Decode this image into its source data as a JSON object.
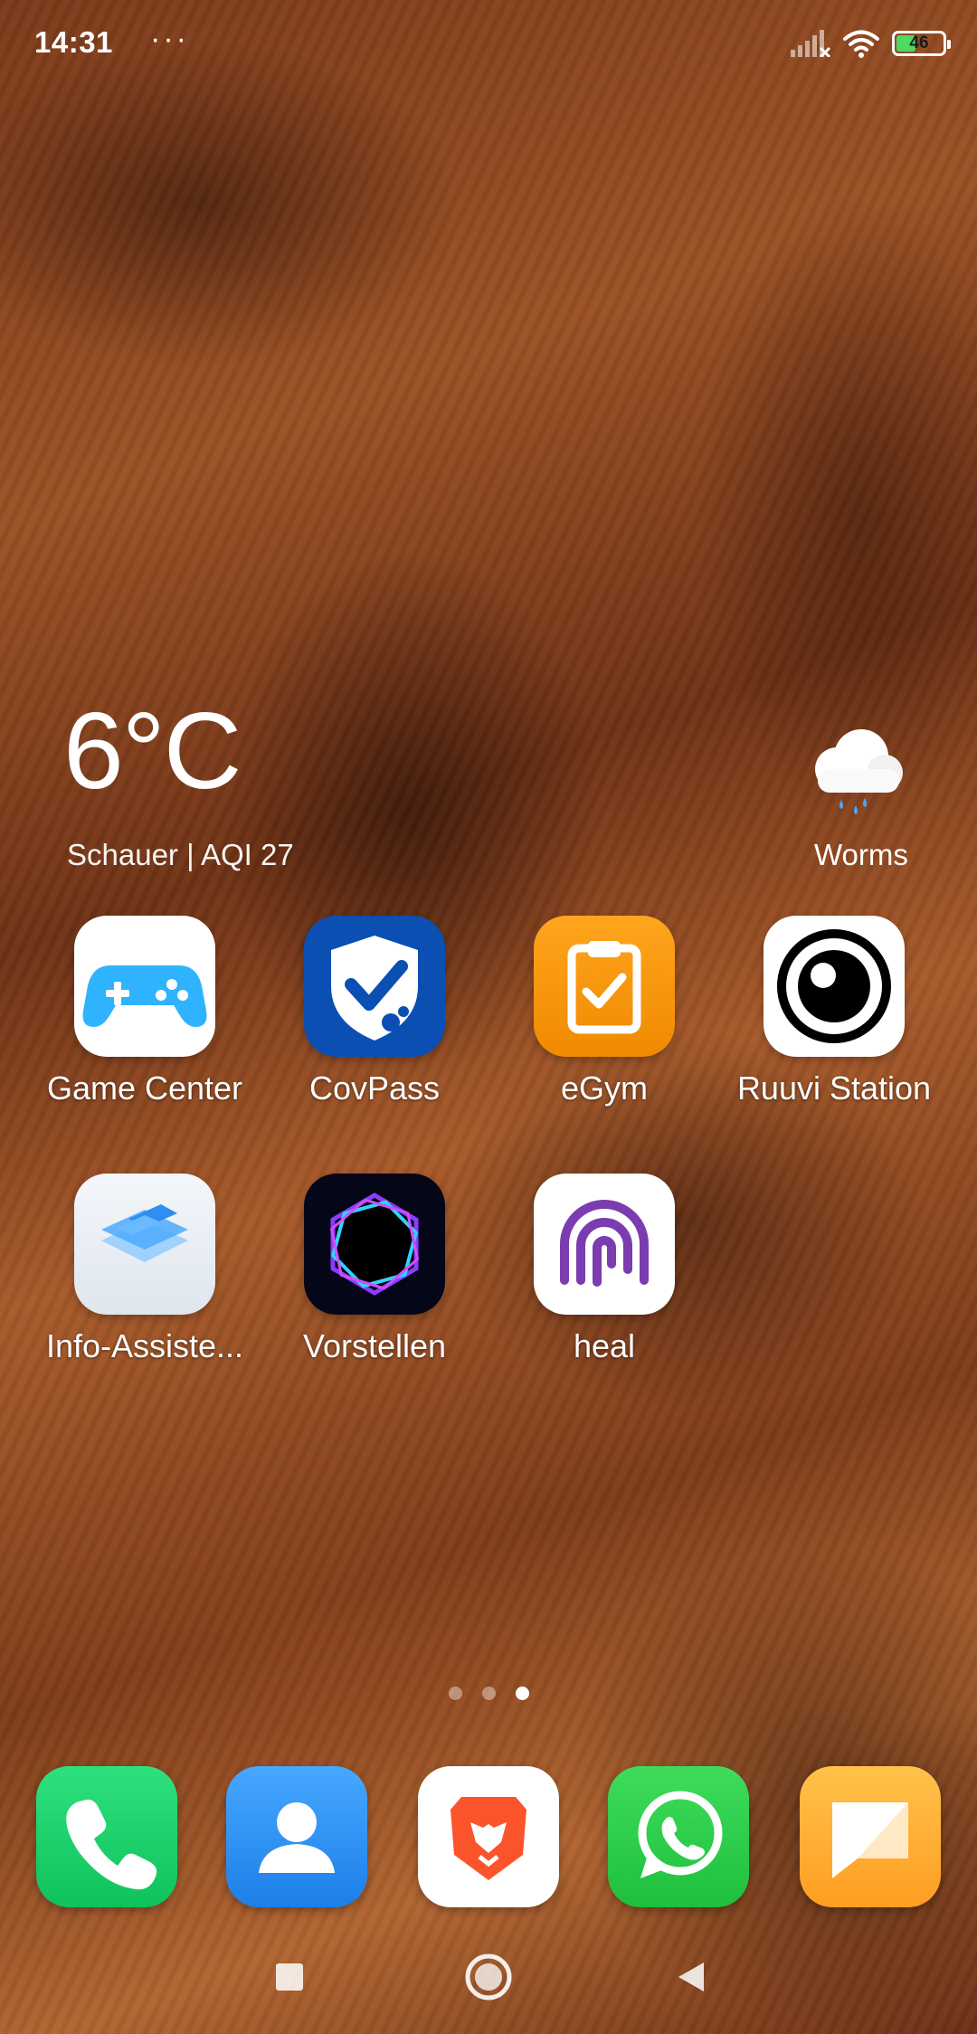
{
  "status_bar": {
    "time": "14:31",
    "dots": "···",
    "battery_level": "46",
    "battery_fraction": 0.46,
    "icons": [
      "signal-icon",
      "wifi-icon",
      "battery-icon"
    ]
  },
  "weather": {
    "temperature": "6°C",
    "description": "Schauer | AQI 27",
    "city": "Worms",
    "icon": "rain-cloud-icon"
  },
  "apps": [
    {
      "label": "Game Center",
      "icon": "gamepad-icon"
    },
    {
      "label": "CovPass",
      "icon": "shield-check-icon"
    },
    {
      "label": "eGym",
      "icon": "clipboard-check-icon"
    },
    {
      "label": "Ruuvi Station",
      "icon": "ruuvi-eye-icon"
    },
    {
      "label": "Info-Assiste...",
      "icon": "layers-icon"
    },
    {
      "label": "Vorstellen",
      "icon": "hexagon-ring-icon"
    },
    {
      "label": "heal",
      "icon": "fingerprint-arcs-icon"
    }
  ],
  "page_indicator": {
    "pages": 3,
    "current": 3
  },
  "dock": [
    "phone-icon",
    "contacts-icon",
    "brave-lion-icon",
    "whatsapp-icon",
    "messages-icon"
  ],
  "navigation": [
    "recents-square-icon",
    "home-circle-icon",
    "back-triangle-icon"
  ]
}
